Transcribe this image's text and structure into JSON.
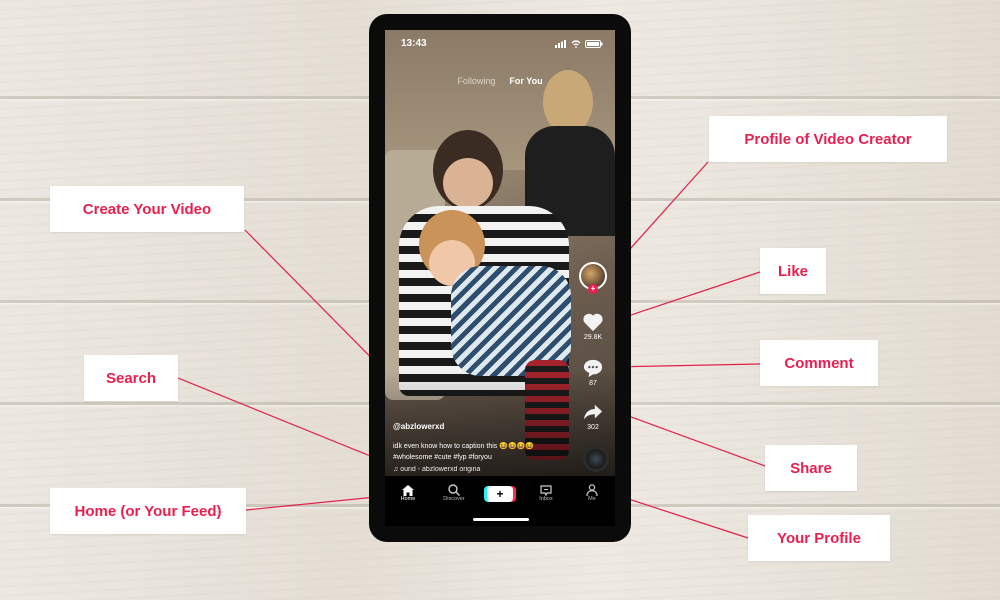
{
  "status_bar": {
    "time": "13:43"
  },
  "feed_tabs": {
    "following": "Following",
    "for_you": "For You"
  },
  "video": {
    "username": "@abzlowerxd",
    "caption": "idk even know how to caption this 😆😆😆😆",
    "hashtags": "#wholesome #cute #fyp #foryou",
    "sound": "ound - abzlowerxd    origina"
  },
  "actions": {
    "likes": "29.8K",
    "comments": "87",
    "shares": "302"
  },
  "bottom_nav": {
    "home": "Home",
    "discover": "Discover",
    "inbox": "Inbox",
    "me": "Me",
    "create": "+"
  },
  "labels": {
    "profile_creator": "Profile of Video Creator",
    "create_video": "Create Your Video",
    "like": "Like",
    "comment": "Comment",
    "search": "Search",
    "share": "Share",
    "home_feed": "Home (or Your Feed)",
    "your_profile": "Your Profile"
  },
  "colors": {
    "accent": "#e8204f",
    "line": "#e0204a"
  },
  "icons": [
    "heart-icon",
    "comment-icon",
    "share-icon",
    "home-icon",
    "search-icon",
    "plus-icon",
    "inbox-icon",
    "person-icon",
    "music-note-icon"
  ]
}
